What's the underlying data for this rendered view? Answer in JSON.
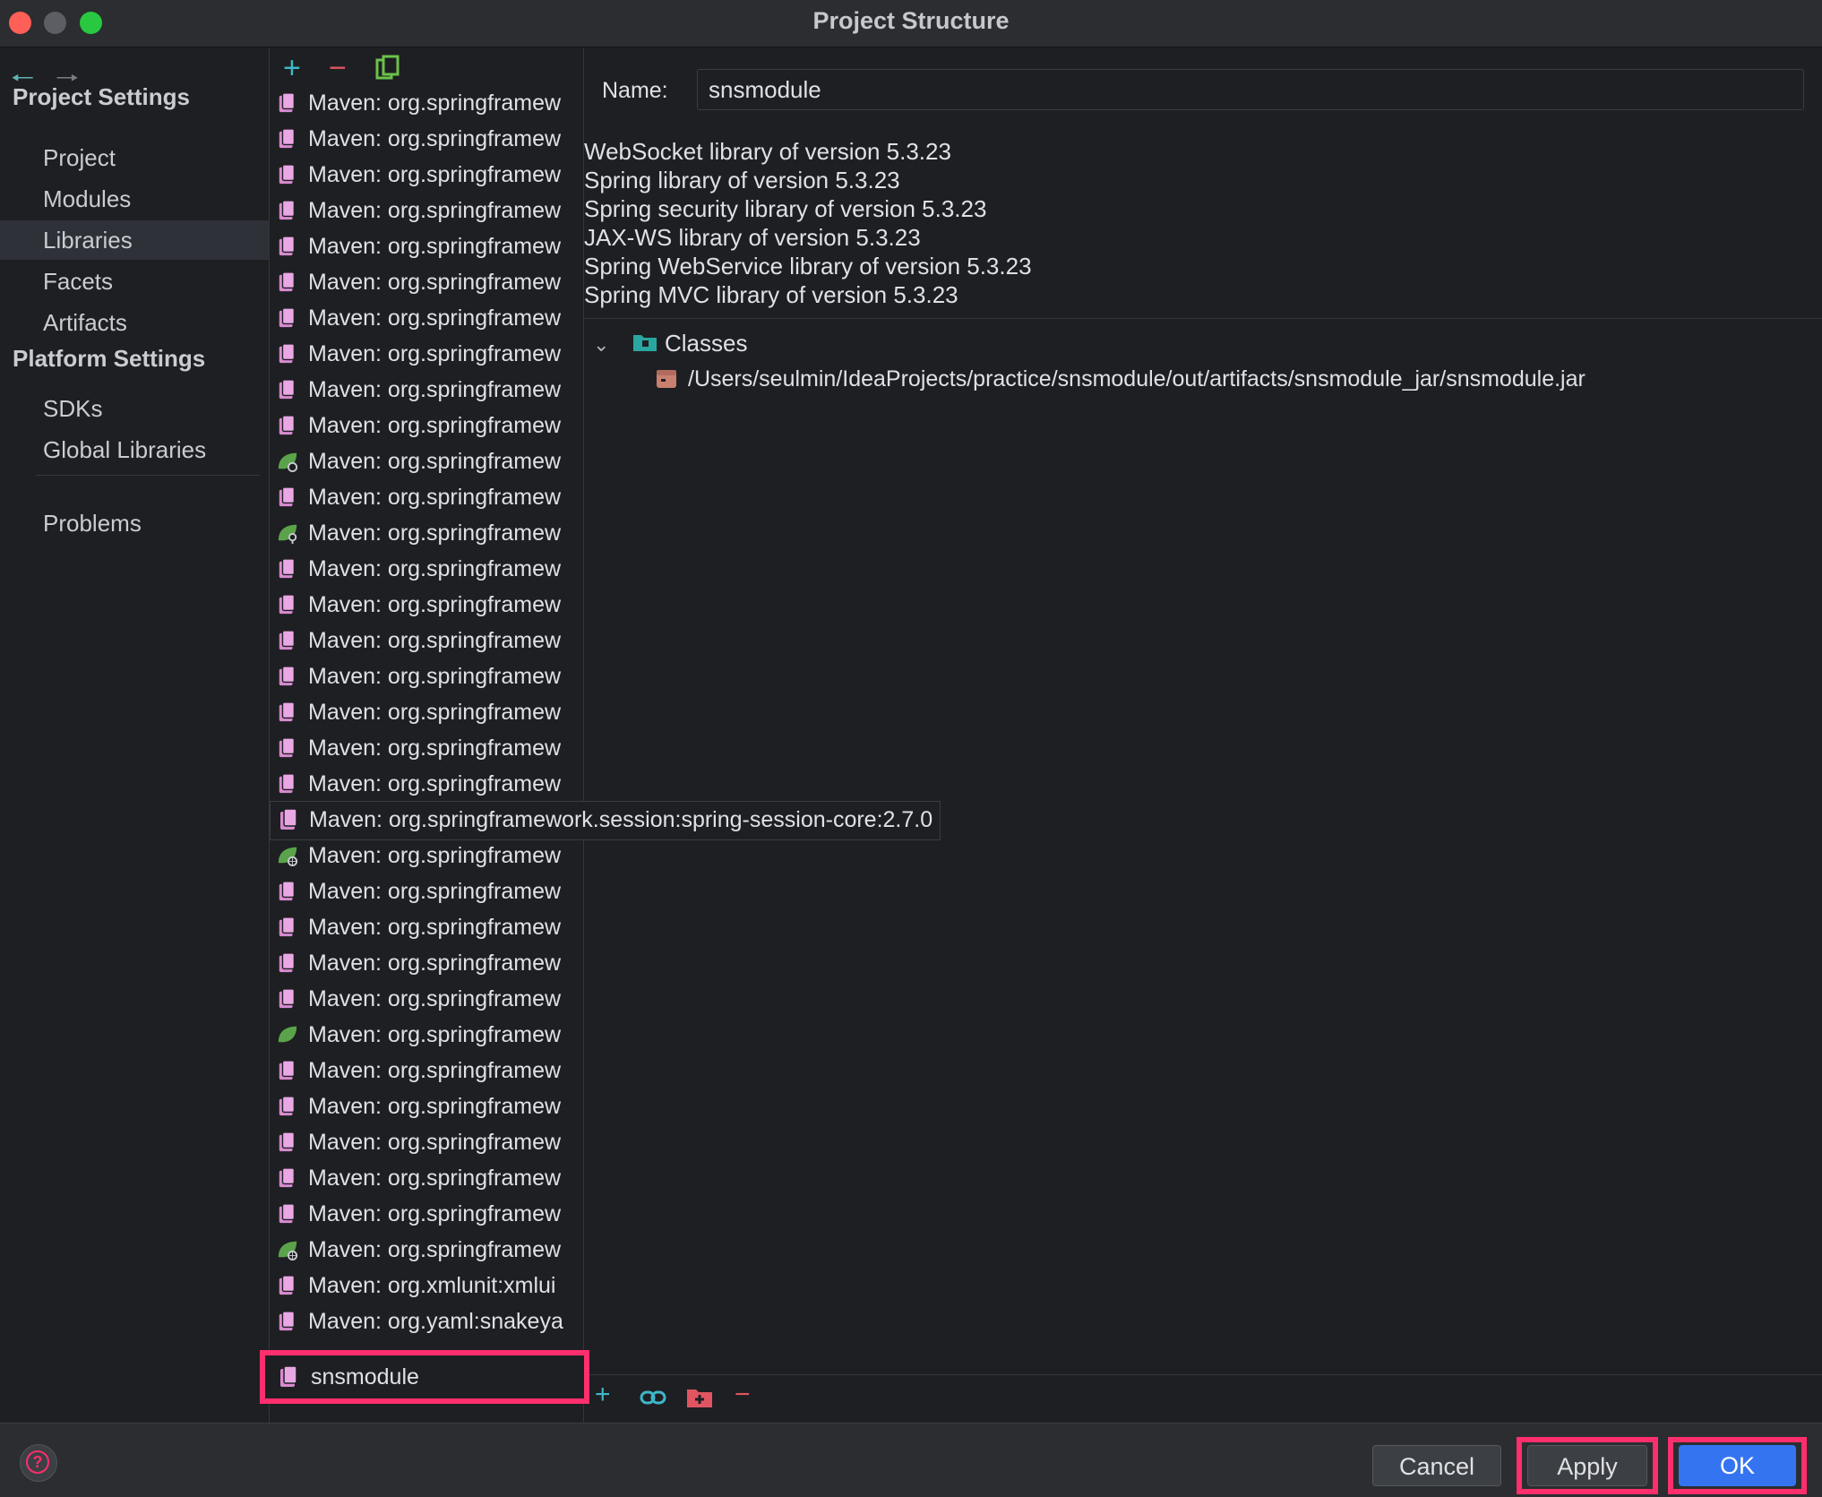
{
  "window": {
    "title": "Project Structure"
  },
  "sidebar": {
    "project_settings_header": "Project Settings",
    "project_items": [
      {
        "label": "Project"
      },
      {
        "label": "Modules"
      },
      {
        "label": "Libraries",
        "selected": true
      },
      {
        "label": "Facets"
      },
      {
        "label": "Artifacts"
      }
    ],
    "platform_settings_header": "Platform Settings",
    "platform_items": [
      {
        "label": "SDKs"
      },
      {
        "label": "Global Libraries"
      }
    ],
    "problems_label": "Problems"
  },
  "library_list": {
    "toolbar": {
      "add_icon": "plus-icon",
      "remove_icon": "minus-icon",
      "copy_icon": "copy-icon"
    },
    "items": [
      {
        "label": "Maven: org.springframew",
        "icon": "library-icon"
      },
      {
        "label": "Maven: org.springframew",
        "icon": "library-icon"
      },
      {
        "label": "Maven: org.springframew",
        "icon": "library-icon"
      },
      {
        "label": "Maven: org.springframew",
        "icon": "library-icon"
      },
      {
        "label": "Maven: org.springframew",
        "icon": "library-icon"
      },
      {
        "label": "Maven: org.springframew",
        "icon": "library-icon"
      },
      {
        "label": "Maven: org.springframew",
        "icon": "library-icon"
      },
      {
        "label": "Maven: org.springframew",
        "icon": "library-icon"
      },
      {
        "label": "Maven: org.springframew",
        "icon": "library-icon"
      },
      {
        "label": "Maven: org.springframew",
        "icon": "library-icon"
      },
      {
        "label": "Maven: org.springframew",
        "icon": "library-icon"
      },
      {
        "label": "Maven: org.springframew",
        "icon": "spring-gear-icon"
      },
      {
        "label": "Maven: org.springframew",
        "icon": "library-icon"
      },
      {
        "label": "Maven: org.springframew",
        "icon": "spring-key-icon"
      },
      {
        "label": "Maven: org.springframew",
        "icon": "library-icon"
      },
      {
        "label": "Maven: org.springframew",
        "icon": "library-icon"
      },
      {
        "label": "Maven: org.springframew",
        "icon": "library-icon"
      },
      {
        "label": "Maven: org.springframew",
        "icon": "library-icon"
      },
      {
        "label": "Maven: org.springframew",
        "icon": "library-icon"
      },
      {
        "label": "Maven: org.springframew",
        "icon": "library-icon"
      },
      {
        "label": "Maven: org.springframew",
        "icon": "library-icon"
      },
      {
        "label": "Maven: org.springframework.session:spring-session-core:2.7.0",
        "icon": "library-icon",
        "tooltip": true
      },
      {
        "label": "Maven: org.springframew",
        "icon": "spring-globe-icon"
      },
      {
        "label": "Maven: org.springframew",
        "icon": "library-icon"
      },
      {
        "label": "Maven: org.springframew",
        "icon": "library-icon"
      },
      {
        "label": "Maven: org.springframew",
        "icon": "library-icon"
      },
      {
        "label": "Maven: org.springframew",
        "icon": "library-icon"
      },
      {
        "label": "Maven: org.springframew",
        "icon": "spring-leaf-icon"
      },
      {
        "label": "Maven: org.springframew",
        "icon": "library-icon"
      },
      {
        "label": "Maven: org.springframew",
        "icon": "library-icon"
      },
      {
        "label": "Maven: org.springframew",
        "icon": "library-icon"
      },
      {
        "label": "Maven: org.springframew",
        "icon": "library-icon"
      },
      {
        "label": "Maven: org.springframew",
        "icon": "library-icon"
      },
      {
        "label": "Maven: org.springframew",
        "icon": "spring-globe-icon"
      },
      {
        "label": "Maven: org.xmlunit:xmlui",
        "icon": "library-icon"
      },
      {
        "label": "Maven: org.yaml:snakeya",
        "icon": "library-icon"
      }
    ],
    "selected_item": {
      "label": "snsmodule",
      "icon": "library-icon"
    }
  },
  "detail": {
    "name_label": "Name:",
    "name_value": "snsmodule",
    "library_types": [
      "WebSocket library of version 5.3.23",
      "Spring library of version 5.3.23",
      "Spring security library of version 5.3.23",
      "JAX-WS library of version 5.3.23",
      "Spring WebService library of version 5.3.23",
      "Spring MVC library of version 5.3.23"
    ],
    "classes_label": "Classes",
    "jar_path": "/Users/seulmin/IdeaProjects/practice/snsmodule/out/artifacts/snsmodule_jar/snsmodule.jar"
  },
  "buttons": {
    "cancel": "Cancel",
    "apply": "Apply",
    "ok": "OK"
  },
  "colors": {
    "accent": "#3574f0",
    "highlight": "#ff2e6d",
    "background": "#1e1f22"
  }
}
